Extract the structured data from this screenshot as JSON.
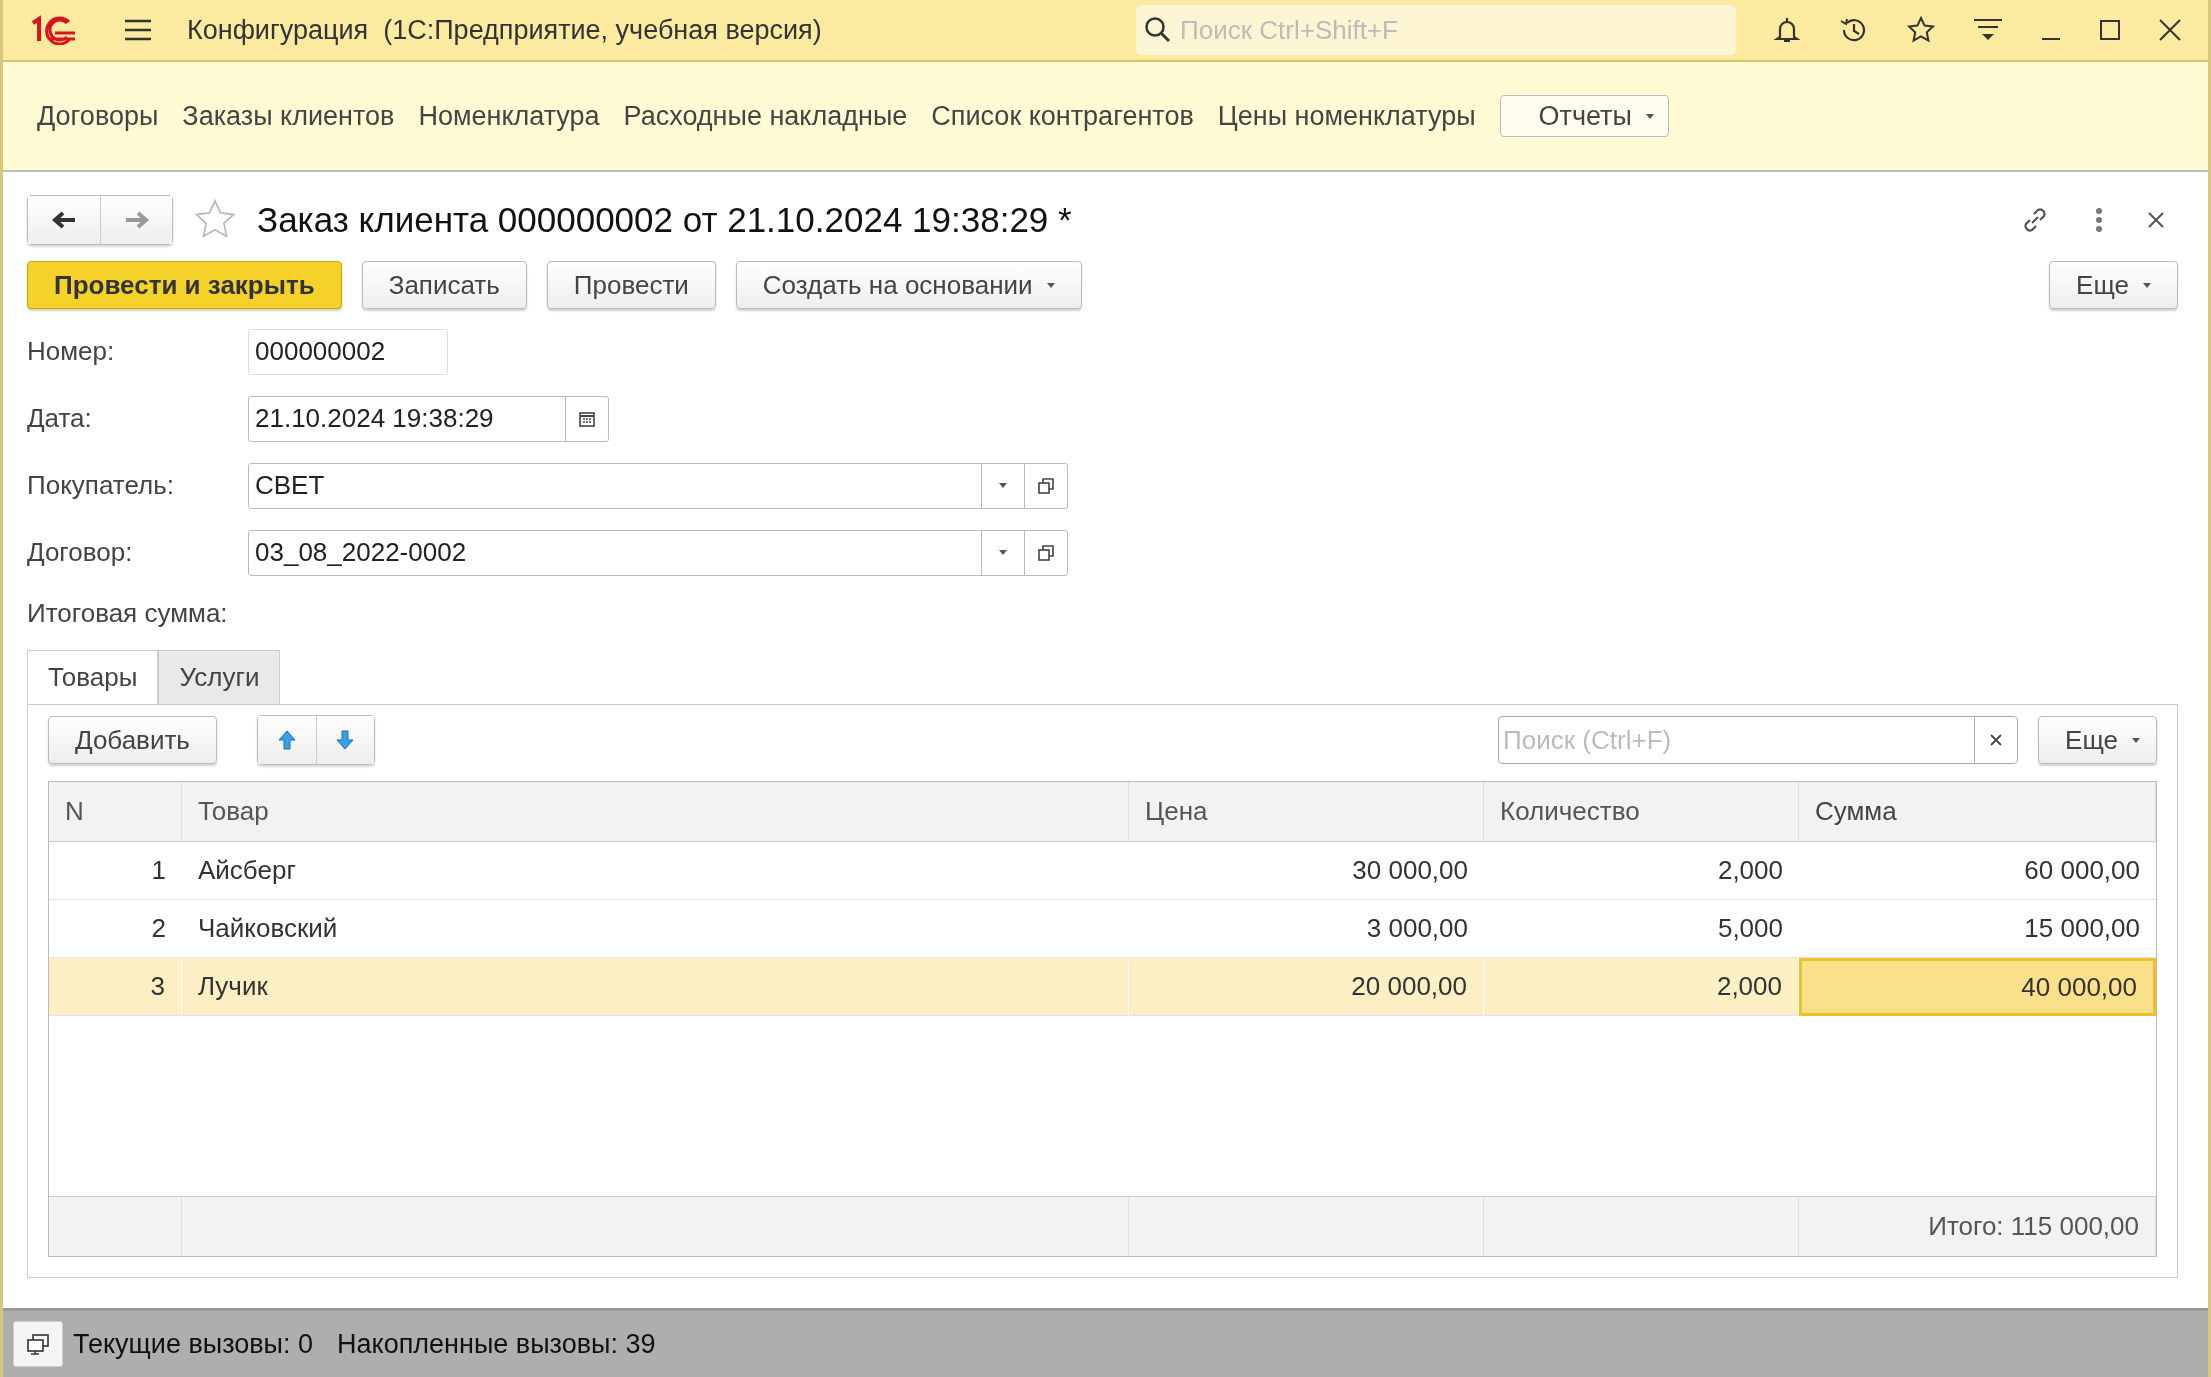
{
  "app_bar": {
    "title": "Конфигурация  (1С:Предприятие, учебная версия)",
    "search": {
      "placeholder": "Поиск Ctrl+Shift+F"
    }
  },
  "sections": [
    {
      "label": "Договоры"
    },
    {
      "label": "Заказы клиентов"
    },
    {
      "label": "Номенклатура"
    },
    {
      "label": "Расходные накладные"
    },
    {
      "label": "Список контрагентов"
    },
    {
      "label": "Цены номенклатуры"
    }
  ],
  "reports_menu": {
    "label": "Отчеты"
  },
  "form": {
    "title": "Заказ клиента 000000002 от 21.10.2024 19:38:29 *",
    "favorite": false,
    "buttons": [
      {
        "label": "Провести и закрыть",
        "kind": "primary"
      },
      {
        "label": "Записать",
        "kind": "plain"
      },
      {
        "label": "Провести",
        "kind": "plain"
      },
      {
        "label": "Создать на основании",
        "kind": "dropdown"
      }
    ],
    "more_button": {
      "label": "Еще"
    },
    "fields": [
      {
        "label": "Номер:",
        "value": "000000002",
        "kind": "text"
      },
      {
        "label": "Дата:",
        "value": "21.10.2024 19:38:29",
        "kind": "date"
      },
      {
        "label": "Покупатель:",
        "value": "СВЕТ",
        "kind": "reference"
      },
      {
        "label": "Договор:",
        "value": "03_08_2022-0002",
        "kind": "reference"
      }
    ],
    "total_label": "Итоговая сумма:",
    "tabs": [
      {
        "label": "Товары",
        "selected": true
      },
      {
        "label": "Услуги",
        "selected": false
      }
    ],
    "table_toolbar": {
      "add_button": "Добавить",
      "search": {
        "placeholder": "Поиск (Ctrl+F)"
      },
      "more_button": "Еще"
    },
    "table": {
      "columns": [
        {
          "label": "N",
          "numeric": true,
          "current": false
        },
        {
          "label": "Товар",
          "numeric": false,
          "current": false
        },
        {
          "label": "Цена",
          "numeric": true,
          "current": false
        },
        {
          "label": "Количество",
          "numeric": true,
          "current": false
        },
        {
          "label": "Сумма",
          "numeric": true,
          "current": true
        }
      ],
      "rows": [
        {
          "cells": [
            "1",
            "Айсберг",
            "30 000,00",
            "2,000",
            "60 000,00"
          ],
          "selected": false
        },
        {
          "cells": [
            "2",
            "Чайковский",
            "3 000,00",
            "5,000",
            "15 000,00"
          ],
          "selected": false
        },
        {
          "cells": [
            "3",
            "Лучик",
            "20 000,00",
            "2,000",
            "40 000,00"
          ],
          "selected": true
        }
      ],
      "footer": "Итого: 115 000,00"
    }
  },
  "status_bar": {
    "items": [
      "Текущие вызовы: 0",
      "Накопленные вызовы: 39"
    ]
  }
}
